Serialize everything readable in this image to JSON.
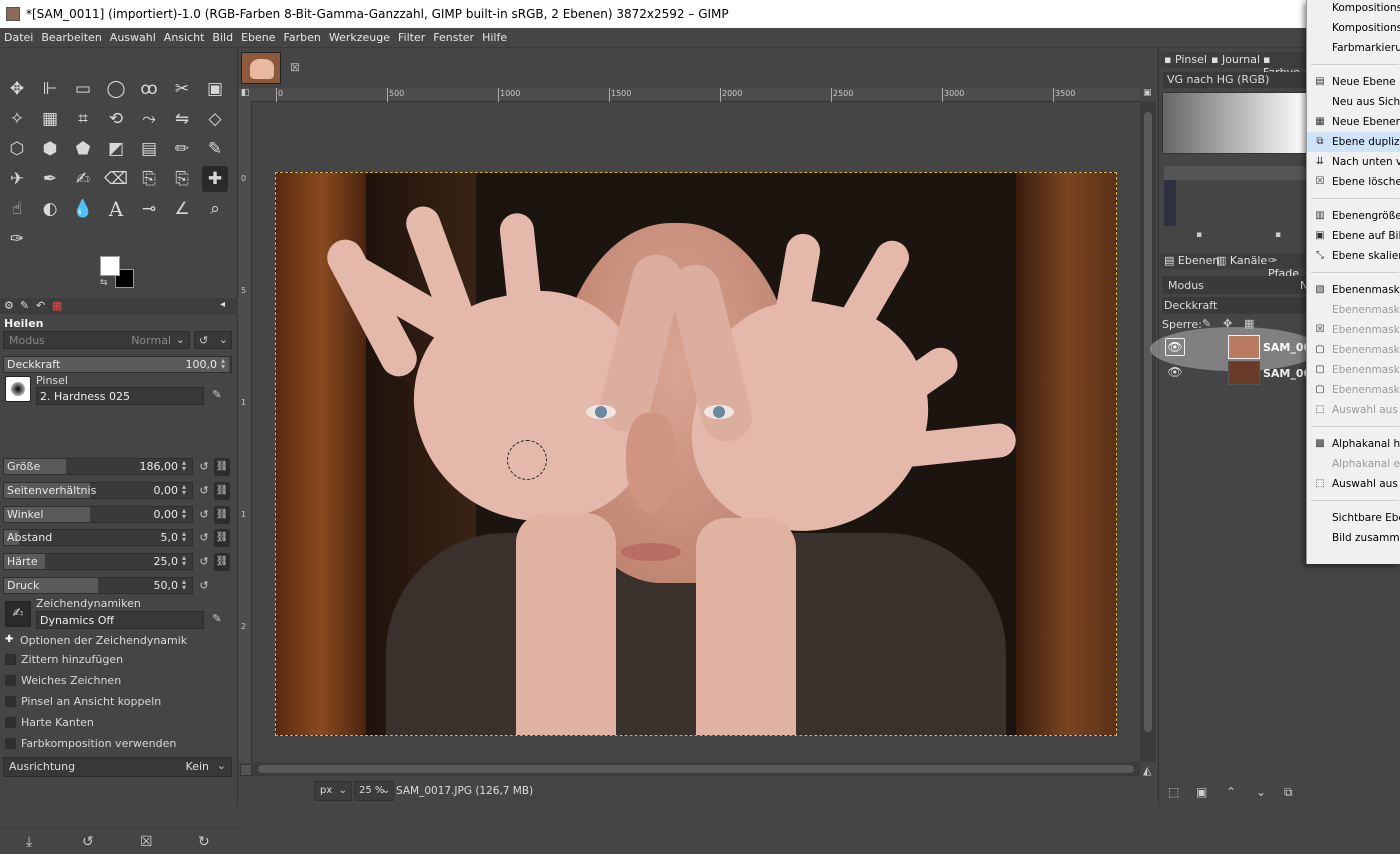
{
  "window": {
    "title": "*[SAM_0011] (importiert)-1.0 (RGB-Farben 8-Bit-Gamma-Ganzzahl, GIMP built-in sRGB, 2 Ebenen) 3872x2592 – GIMP"
  },
  "menubar": [
    "Datei",
    "Bearbeiten",
    "Auswahl",
    "Ansicht",
    "Bild",
    "Ebene",
    "Farben",
    "Werkzeuge",
    "Filter",
    "Fenster",
    "Hilfe"
  ],
  "toolbox": {
    "icons": [
      "move-tool-icon",
      "align-tool-icon",
      "rect-select-icon",
      "ellipse-select-icon",
      "lasso-icon",
      "scissors-select-icon",
      "foreground-select-icon",
      "fuzzy-select-icon",
      "by-color-select-icon",
      "crop-icon",
      "unified-transform-icon",
      "warp-transform-icon",
      "flip-icon",
      "perspective-icon",
      "cage-icon",
      "3d-transform-icon",
      "handle-transform-icon",
      "bucket-fill-icon",
      "gradient-icon",
      "paintbrush-icon",
      "pencil-icon",
      "airbrush-icon",
      "ink-icon",
      "mypaint-brush-icon",
      "eraser-icon",
      "clone-icon",
      "perspective-clone-icon",
      "heal-icon",
      "smudge-icon",
      "dodge-burn-icon",
      "blur-icon",
      "text-icon",
      "color-picker-icon",
      "measure-icon",
      "zoom-icon",
      "paths-icon"
    ],
    "fg_color": "#ffffff",
    "bg_color": "#000000"
  },
  "tool_options": {
    "title": "Heilen",
    "mode_label": "Modus",
    "mode_value": "Normal",
    "opacity_label": "Deckkraft",
    "opacity_value": "100,0",
    "brush_label": "Pinsel",
    "brush_value": "2. Hardness 025",
    "sliders": [
      {
        "label": "Größe",
        "value": "186,00",
        "fill": 0.33
      },
      {
        "label": "Seitenverhältnis",
        "value": "0,00",
        "fill": 0.46
      },
      {
        "label": "Winkel",
        "value": "0,00",
        "fill": 0.46
      },
      {
        "label": "Abstand",
        "value": "5,0",
        "fill": 0.08
      },
      {
        "label": "Härte",
        "value": "25,0",
        "fill": 0.22
      },
      {
        "label": "Druck",
        "value": "50,0",
        "fill": 0.5
      }
    ],
    "dynamics_label": "Zeichendynamiken",
    "dynamics_value": "Dynamics Off",
    "dynamics_options": "Optionen der Zeichendynamik",
    "checkboxes": [
      "Zittern hinzufügen",
      "Weiches Zeichnen",
      "Pinsel an Ansicht koppeln",
      "Harte Kanten",
      "Farbkomposition verwenden"
    ],
    "alignment_label": "Ausrichtung",
    "alignment_value": "Kein"
  },
  "ruler": {
    "marks": [
      "0",
      "500",
      "1000",
      "1500",
      "2000",
      "2500",
      "3000",
      "3500"
    ],
    "vmarks": [
      "0",
      "5",
      "1",
      "1",
      "2"
    ]
  },
  "status": {
    "unit": "px",
    "zoom": "25 %",
    "file": "SAM_0017.JPG (126,7 MB)"
  },
  "right_dock": {
    "tabs_top": [
      "Pinsel",
      "Journal",
      "Farbve"
    ],
    "gradient_name": "VG nach HG (RGB)",
    "tabs_layers": [
      "Ebenen",
      "Kanäle",
      "Pfade"
    ],
    "mode_label": "Modus",
    "opacity_label": "Deckkraft",
    "lock_label": "Sperre:",
    "layers": [
      "SAM_00",
      "SAM_00"
    ]
  },
  "context_menu": {
    "items": [
      {
        "label": "Kompositionsra",
        "dis": false
      },
      {
        "label": "Kompositionsm",
        "dis": false
      },
      {
        "label": "Farbmarkierung",
        "dis": false
      },
      {
        "label": "Neue Ebene ...",
        "dis": false,
        "icon": "new-layer-icon"
      },
      {
        "label": "Neu aus Sichtb",
        "dis": false
      },
      {
        "label": "Neue Ebenengr",
        "dis": false,
        "icon": "new-group-icon"
      },
      {
        "label": "Ebene duplizier",
        "dis": false,
        "hl": true,
        "icon": "duplicate-icon"
      },
      {
        "label": "Nach unten ver",
        "dis": false,
        "icon": "merge-down-icon"
      },
      {
        "label": "Ebene löschen",
        "dis": false,
        "icon": "delete-icon"
      },
      {
        "label": "Ebenengröße ...",
        "dis": false,
        "icon": "layer-size-icon"
      },
      {
        "label": "Ebene auf Bildg",
        "dis": false,
        "icon": "layer-to-image-icon"
      },
      {
        "label": "Ebene skalieren",
        "dis": false,
        "icon": "scale-layer-icon"
      },
      {
        "label": "Ebenenmaske h",
        "dis": false,
        "icon": "add-mask-icon"
      },
      {
        "label": "Ebenenmaske a",
        "dis": true
      },
      {
        "label": "Ebenenmaske l",
        "dis": true,
        "icon": "delete-mask-icon"
      },
      {
        "label": "Ebenenmaske a",
        "dis": true,
        "icon": "checkbox-icon"
      },
      {
        "label": "Ebenenmaske b",
        "dis": true,
        "icon": "checkbox-icon"
      },
      {
        "label": "Ebenenmaske d",
        "dis": true,
        "icon": "checkbox-icon"
      },
      {
        "label": "Auswahl aus M",
        "dis": true,
        "icon": "selection-icon"
      },
      {
        "label": "Alphakanal hin",
        "dis": false,
        "icon": "alpha-icon"
      },
      {
        "label": "Alphakanal ent",
        "dis": true
      },
      {
        "label": "Auswahl aus Al",
        "dis": false,
        "icon": "selection-icon"
      },
      {
        "label": "Sichtbare Eben",
        "dis": false
      },
      {
        "label": "Bild zusammen",
        "dis": false
      }
    ]
  }
}
